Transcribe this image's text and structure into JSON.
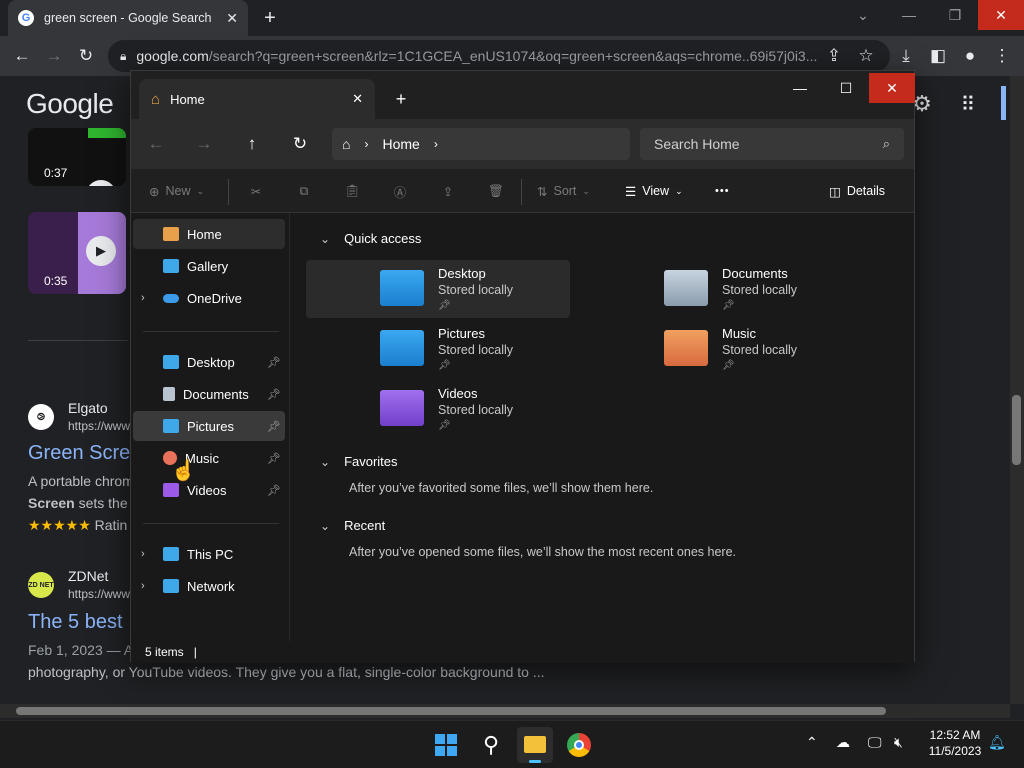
{
  "chrome": {
    "tab_title": "green screen - Google Search",
    "new_tab": "+",
    "url_domain": "google.com",
    "url_rest": "/search?q=green+screen&rlz=1C1GCEA_enUS1074&oq=green+screen&aqs=chrome..69i57j0i3..."
  },
  "google": {
    "logo": "Google",
    "videos": [
      {
        "duration": "0:37"
      },
      {
        "duration": "0:35"
      }
    ],
    "results": [
      {
        "favicon": "⧁",
        "source": "Elgato",
        "url": "https://www",
        "title": "Green Scre",
        "snippet1": "A portable chrom",
        "snippet2_bold": "Screen",
        "snippet2": " sets the",
        "rating_stars": "★★★★★",
        "rating_text": "Ratin"
      },
      {
        "favicon": "ZD NET",
        "source": "ZDNet",
        "url": "https://www",
        "title": "The 5 best",
        "date": "Feb 1, 2023 — A",
        "snippet": "photography, or YouTube videos. They give you a flat, single-color background to ..."
      }
    ]
  },
  "explorer": {
    "tab_title": "Home",
    "breadcrumb": "Home",
    "search_placeholder": "Search Home",
    "commands": {
      "new": "New",
      "sort": "Sort",
      "view": "View",
      "more": "•••",
      "details": "Details"
    },
    "sidebar": {
      "top": [
        {
          "label": "Home",
          "color": "#e8a04a"
        },
        {
          "label": "Gallery",
          "color": "#3fa8e8"
        },
        {
          "label": "OneDrive",
          "color": "#3b9be8"
        }
      ],
      "pinned": [
        {
          "label": "Desktop",
          "color": "#3fa8e8"
        },
        {
          "label": "Documents",
          "color": "#b8c4d0"
        },
        {
          "label": "Pictures",
          "color": "#3fa8e8"
        },
        {
          "label": "Music",
          "color": "#e8725a"
        },
        {
          "label": "Videos",
          "color": "#9b5ae8"
        }
      ],
      "bottom": [
        {
          "label": "This PC",
          "color": "#3fa8e8"
        },
        {
          "label": "Network",
          "color": "#3fa8e8"
        }
      ]
    },
    "quick_access": {
      "title": "Quick access",
      "items": [
        {
          "name": "Desktop",
          "status": "Stored locally",
          "color": "#2b9be0"
        },
        {
          "name": "Documents",
          "status": "Stored locally",
          "color": "#a8b8c8"
        },
        {
          "name": "Pictures",
          "status": "Stored locally",
          "color": "#2b9be0"
        },
        {
          "name": "Music",
          "status": "Stored locally",
          "color": "#e07a50"
        },
        {
          "name": "Videos",
          "status": "Stored locally",
          "color": "#8b50d8"
        }
      ]
    },
    "favorites": {
      "title": "Favorites",
      "empty": "After you’ve favorited some files, we’ll show them here."
    },
    "recent": {
      "title": "Recent",
      "empty": "After you’ve opened some files, we’ll show the most recent ones here."
    },
    "status": "5 items"
  },
  "taskbar": {
    "time": "12:52 AM",
    "date": "11/5/2023"
  }
}
